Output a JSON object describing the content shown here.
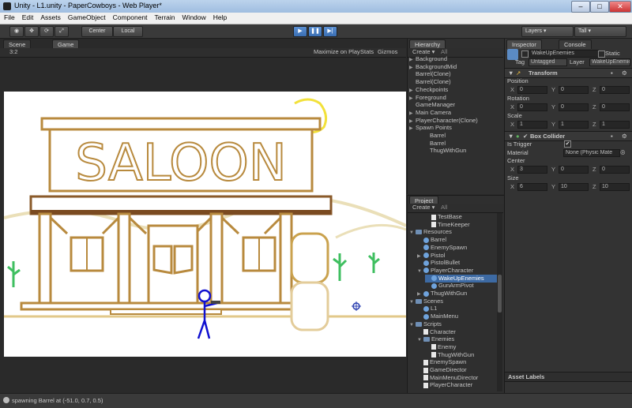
{
  "window": {
    "title": "Unity - L1.unity - PaperCowboys - Web Player*"
  },
  "menu": [
    "File",
    "Edit",
    "Assets",
    "GameObject",
    "Component",
    "Terrain",
    "Window",
    "Help"
  ],
  "toolbar": {
    "center": "Center",
    "local": "Local",
    "layers": "Layers",
    "layout": "Tall"
  },
  "tabs": {
    "scene": "Scene",
    "game": "Game",
    "hierarchy": "Hierarchy",
    "project": "Project",
    "inspector": "Inspector",
    "console": "Console"
  },
  "game_bar": {
    "aspect": "3:2",
    "maximize": "Maximize on Play",
    "stats": "Stats",
    "gizmos": "Gizmos"
  },
  "scene_art": {
    "sign_text": "SALOON"
  },
  "hierarchy": {
    "create": "Create",
    "search": "All",
    "items": [
      {
        "label": "Background",
        "indent": 0,
        "arrow": true
      },
      {
        "label": "BackgroundMid",
        "indent": 0,
        "arrow": true
      },
      {
        "label": "Barrel(Clone)",
        "indent": 0,
        "arrow": false
      },
      {
        "label": "Barrel(Clone)",
        "indent": 0,
        "arrow": false
      },
      {
        "label": "Checkpoints",
        "indent": 0,
        "arrow": true
      },
      {
        "label": "Foreground",
        "indent": 0,
        "arrow": true
      },
      {
        "label": "GameManager",
        "indent": 0,
        "arrow": false
      },
      {
        "label": "Main Camera",
        "indent": 0,
        "arrow": true
      },
      {
        "label": "PlayerCharacter(Clone)",
        "indent": 0,
        "arrow": true
      },
      {
        "label": "Spawn Points",
        "indent": 0,
        "arrow": true
      },
      {
        "label": "Barrel",
        "indent": 1,
        "arrow": false
      },
      {
        "label": "Barrel",
        "indent": 1,
        "arrow": false
      },
      {
        "label": "ThugWithGun",
        "indent": 1,
        "arrow": false
      }
    ]
  },
  "project": {
    "create": "Create",
    "search": "All",
    "items": [
      {
        "label": "TestBase",
        "indent": 2,
        "icon": "script",
        "sel": false,
        "arrow": ""
      },
      {
        "label": "TimeKeeper",
        "indent": 2,
        "icon": "script",
        "sel": false,
        "arrow": ""
      },
      {
        "label": "Resources",
        "indent": 0,
        "icon": "folder",
        "sel": false,
        "arrow": "▼"
      },
      {
        "label": "Barrel",
        "indent": 1,
        "icon": "prefab",
        "sel": false,
        "arrow": ""
      },
      {
        "label": "EnemySpawn",
        "indent": 1,
        "icon": "prefab",
        "sel": false,
        "arrow": ""
      },
      {
        "label": "Pistol",
        "indent": 1,
        "icon": "prefab",
        "sel": false,
        "arrow": "▶"
      },
      {
        "label": "PistolBullet",
        "indent": 1,
        "icon": "prefab",
        "sel": false,
        "arrow": ""
      },
      {
        "label": "PlayerCharacter",
        "indent": 1,
        "icon": "prefab",
        "sel": false,
        "arrow": "▼"
      },
      {
        "label": "WakeUpEnemies",
        "indent": 2,
        "icon": "prefab",
        "sel": true,
        "arrow": ""
      },
      {
        "label": "GunArmPivot",
        "indent": 2,
        "icon": "prefab",
        "sel": false,
        "arrow": ""
      },
      {
        "label": "ThugWithGun",
        "indent": 1,
        "icon": "prefab",
        "sel": false,
        "arrow": "▶"
      },
      {
        "label": "Scenes",
        "indent": 0,
        "icon": "folder",
        "sel": false,
        "arrow": "▼"
      },
      {
        "label": "L1",
        "indent": 1,
        "icon": "scene",
        "sel": false,
        "arrow": ""
      },
      {
        "label": "MainMenu",
        "indent": 1,
        "icon": "scene",
        "sel": false,
        "arrow": ""
      },
      {
        "label": "Scripts",
        "indent": 0,
        "icon": "folder",
        "sel": false,
        "arrow": "▼"
      },
      {
        "label": "Character",
        "indent": 1,
        "icon": "script",
        "sel": false,
        "arrow": ""
      },
      {
        "label": "Enemies",
        "indent": 1,
        "icon": "folder",
        "sel": false,
        "arrow": "▼"
      },
      {
        "label": "Enemy",
        "indent": 2,
        "icon": "script",
        "sel": false,
        "arrow": ""
      },
      {
        "label": "ThugWithGun",
        "indent": 2,
        "icon": "script",
        "sel": false,
        "arrow": ""
      },
      {
        "label": "EnemySpawn",
        "indent": 1,
        "icon": "script",
        "sel": false,
        "arrow": ""
      },
      {
        "label": "GameDirector",
        "indent": 1,
        "icon": "script",
        "sel": false,
        "arrow": ""
      },
      {
        "label": "MainMenuDirector",
        "indent": 1,
        "icon": "script",
        "sel": false,
        "arrow": ""
      },
      {
        "label": "PlayerCharacter",
        "indent": 1,
        "icon": "script",
        "sel": false,
        "arrow": ""
      }
    ]
  },
  "inspector": {
    "object_name": "WakeUpEnemies",
    "static": "Static",
    "tag_label": "Tag",
    "tag_value": "Untagged",
    "layer_label": "Layer",
    "layer_value": "WakeUpEnemies",
    "transform": {
      "title": "Transform",
      "position_label": "Position",
      "rotation_label": "Rotation",
      "scale_label": "Scale",
      "position": [
        "0",
        "0",
        "0"
      ],
      "rotation": [
        "0",
        "0",
        "0"
      ],
      "scale": [
        "1",
        "1",
        "1"
      ]
    },
    "box_collider": {
      "title": "Box Collider",
      "is_trigger_label": "Is Trigger",
      "material_label": "Material",
      "material_value": "None (Physic Mate",
      "center_label": "Center",
      "size_label": "Size",
      "center": [
        "3",
        "0",
        "0"
      ],
      "size": [
        "6",
        "10",
        "10"
      ]
    },
    "axis": [
      "X",
      "Y",
      "Z"
    ],
    "asset_labels": "Asset Labels"
  },
  "status": {
    "message": "spawning Barrel at (-51.0, 0.7, 0.5)"
  }
}
